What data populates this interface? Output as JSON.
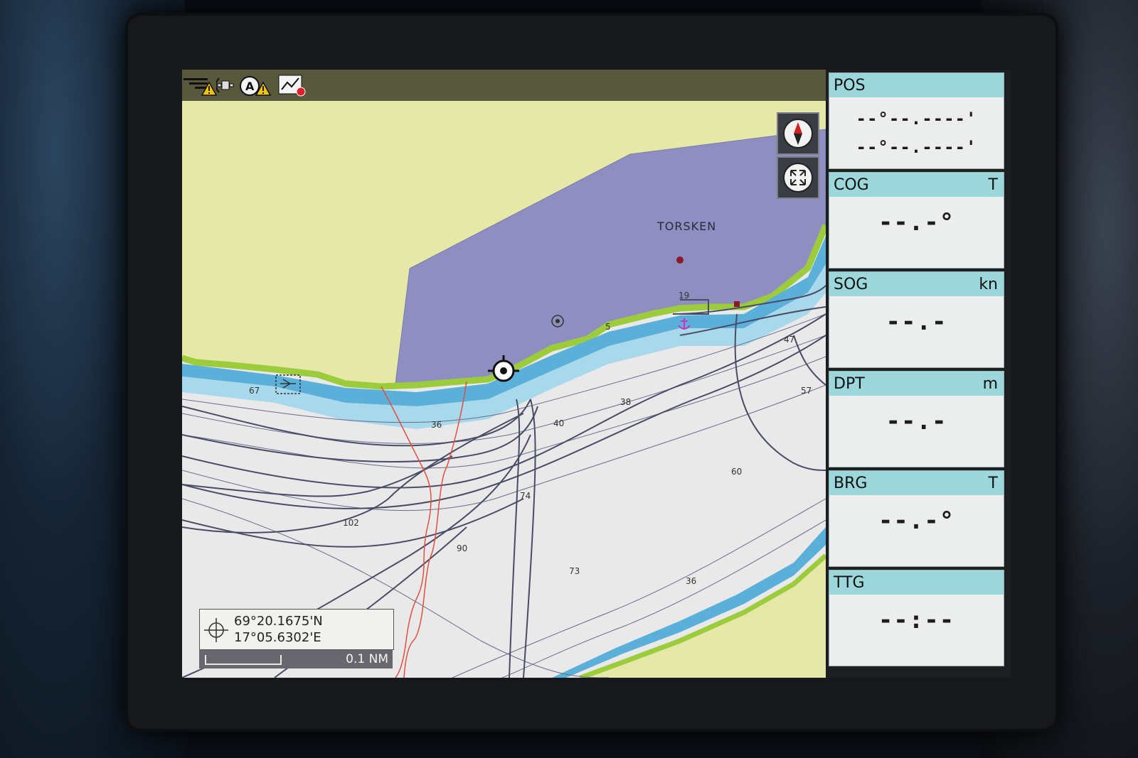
{
  "status_bar": {
    "icons": [
      "gps-warning-icon",
      "satellite-icon",
      "autopilot-warning-icon",
      "track-record-icon"
    ]
  },
  "chart": {
    "place_name": "TORSKEN",
    "depth_soundings": [
      "19",
      "5",
      "67",
      "36",
      "40",
      "38",
      "57",
      "60",
      "74",
      "102",
      "90",
      "73",
      "36",
      "47"
    ],
    "colors": {
      "land": "#e6e8a8",
      "restricted_area": "#8e8fc0",
      "shallow_dark": "#5ab0d8",
      "shallow_light": "#a8d8ec",
      "deep_water": "#e9e9e9",
      "coastline": "#9ccb3c",
      "track": "#4a4c66",
      "cable": "#e05040"
    }
  },
  "map_buttons": {
    "north_up": "north-arrow-icon",
    "fullscreen": "expand-icon"
  },
  "cursor_position": {
    "latitude": "69°20.1675'N",
    "longitude": "17°05.6302'E"
  },
  "scale": {
    "label": "0.1 NM"
  },
  "data_panels": [
    {
      "title": "POS",
      "unit": "",
      "value_line1": "--°--.----'",
      "value_line2": "--°--.----'"
    },
    {
      "title": "COG",
      "unit": "T",
      "value": "--.-°"
    },
    {
      "title": "SOG",
      "unit": "kn",
      "value": "--.-"
    },
    {
      "title": "DPT",
      "unit": "m",
      "value": "--.-"
    },
    {
      "title": "BRG",
      "unit": "T",
      "value": "--.-°"
    },
    {
      "title": "TTG",
      "unit": "",
      "value": "--:--"
    }
  ]
}
